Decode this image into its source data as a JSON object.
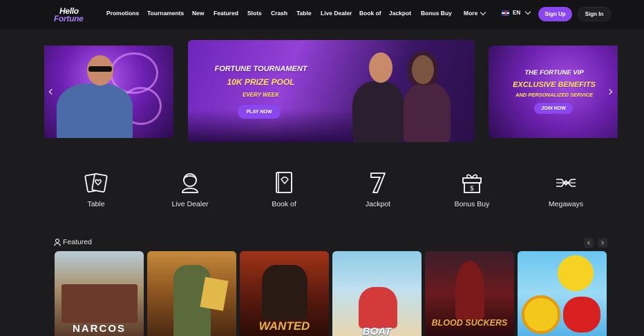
{
  "brand": {
    "logo_line1": "Hello",
    "logo_line2": "Fortune",
    "accent": "#8a47f0"
  },
  "nav": {
    "items": [
      "Promotions",
      "Tournaments",
      "New",
      "Featured",
      "Slots",
      "Crash",
      "Table",
      "Live Dealer",
      "Book of",
      "Jackpot",
      "Bonus Buy"
    ],
    "more_label": "More",
    "language": "EN",
    "signup_label": "Sign Up",
    "signin_label": "Sign In"
  },
  "banners": {
    "main": {
      "line1": "FORTUNE TOURNAMENT",
      "line2": "10K PRIZE POOL",
      "line3": "EVERY WEEK",
      "button": "PLAY NOW"
    },
    "right": {
      "line1": "THE FORTUNE VIP",
      "line2": "EXCLUSIVE BENEFITS",
      "line3": "AND PERSONALIZED SERVICE",
      "button": "JOIN NOW"
    }
  },
  "categories": [
    {
      "label": "Table",
      "icon": "cards-icon"
    },
    {
      "label": "Live Dealer",
      "icon": "dealer-icon"
    },
    {
      "label": "Book of",
      "icon": "book-icon"
    },
    {
      "label": "Jackpot",
      "icon": "seven-icon"
    },
    {
      "label": "Bonus Buy",
      "icon": "gift-icon"
    },
    {
      "label": "Megaways",
      "icon": "megaways-icon"
    }
  ],
  "featured": {
    "title": "Featured",
    "games": [
      "NARCOS",
      "",
      "WANTED",
      "BOAT",
      "BLOOD SUCKERS",
      ""
    ]
  }
}
